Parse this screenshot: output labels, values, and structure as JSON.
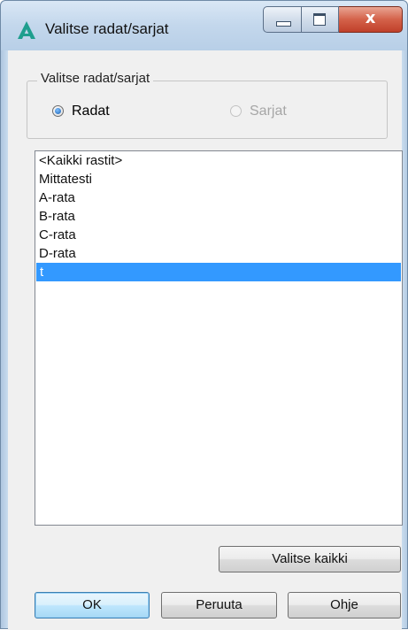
{
  "window": {
    "title": "Valitse radat/sarjat",
    "icon": "app-logo-a-icon"
  },
  "titlebar_buttons": {
    "minimize_icon": "minimize-icon",
    "maximize_icon": "maximize-icon",
    "close_glyph": "x"
  },
  "group": {
    "label": "Valitse radat/sarjat",
    "options": [
      {
        "label": "Radat",
        "checked": true,
        "enabled": true
      },
      {
        "label": "Sarjat",
        "checked": false,
        "enabled": false
      }
    ]
  },
  "list": {
    "items": [
      "<Kaikki rastit>",
      "Mittatesti",
      "A-rata",
      "B-rata",
      "C-rata",
      "D-rata",
      "t"
    ],
    "selected_index": 6
  },
  "buttons": {
    "select_all": "Valitse kaikki",
    "ok": "OK",
    "cancel": "Peruuta",
    "help": "Ohje"
  },
  "colors": {
    "accent": "#3399ff",
    "close_button": "#c0402a",
    "logo": "#1f9e8e"
  }
}
